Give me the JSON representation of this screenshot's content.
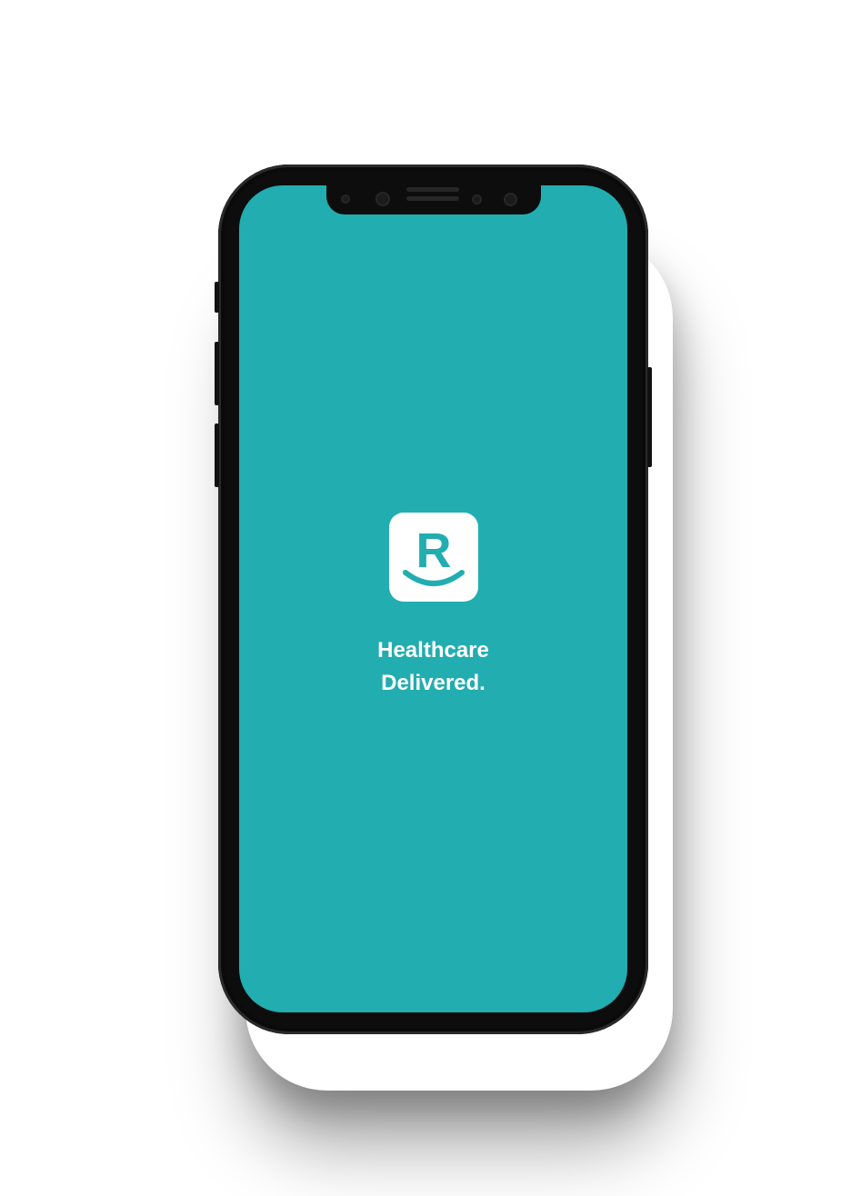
{
  "app": {
    "logo_letter": "R",
    "tagline_line1": "Healthcare",
    "tagline_line2": "Delivered."
  },
  "colors": {
    "screen_background": "#22adb0",
    "logo_background": "#ffffff",
    "logo_foreground": "#22adb0",
    "device_frame": "#0d0d0d"
  },
  "icons": {
    "logo": "r-smile-logo-icon"
  }
}
